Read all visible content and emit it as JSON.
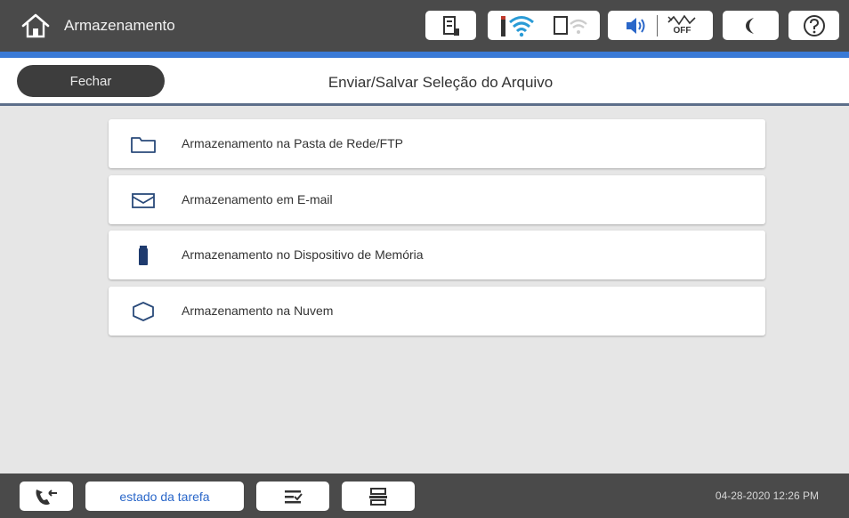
{
  "header": {
    "title": "Armazenamento",
    "home_icon": "home-icon",
    "status_icons": [
      "ink-levels-icon",
      "wifi-icon",
      "wifi-direct-icon",
      "volume-icon",
      "quiet-mode-off-icon",
      "sleep-mode-icon",
      "help-icon"
    ],
    "quiet_mode_label": "OFF",
    "accent_color": "#3a7ad6"
  },
  "subheader": {
    "close_label": "Fechar",
    "page_title": "Enviar/Salvar Seleção do Arquivo"
  },
  "menu": {
    "items": [
      {
        "label": "Armazenamento na Pasta de Rede/FTP",
        "icon": "folder-icon"
      },
      {
        "label": "Armazenamento em E-mail",
        "icon": "envelope-icon"
      },
      {
        "label": "Armazenamento no Dispositivo de Memória",
        "icon": "memory-device-icon"
      },
      {
        "label": "Armazenamento na Nuvem",
        "icon": "cloud-icon"
      }
    ]
  },
  "footer": {
    "job_status_label": "estado da tarefa",
    "icons": [
      "fax-icon",
      "job-queue-icon",
      "print-stop-icon"
    ],
    "datetime": "04-28-2020 12:26 PM"
  }
}
